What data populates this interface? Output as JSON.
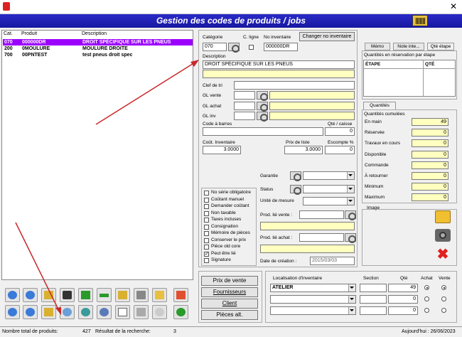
{
  "header": {
    "title": "Gestion des codes de produits / jobs"
  },
  "window": {
    "close": "✕"
  },
  "list": {
    "columns": [
      "Cat.",
      "Produit",
      "Description"
    ],
    "rows": [
      {
        "cat": "070",
        "produit": "000000DR",
        "desc": "DROIT SPÉCIFIQUE SUR LES PNEUS",
        "selected": true
      },
      {
        "cat": "200",
        "produit": "0MOULURE",
        "desc": "MOULURE DROITE",
        "selected": false
      },
      {
        "cat": "700",
        "produit": "00PNTEST",
        "desc": "test pneus droit spec",
        "selected": false
      }
    ]
  },
  "form": {
    "categorie_label": "Catégorie",
    "categorie": "070",
    "cligne_label": "C. ligne",
    "noinv_label": "No inventaire",
    "noinv": "000000DR",
    "change_btn": "Changer no inventaire",
    "description_label": "Description",
    "description": "DROIT SPÉCIFIQUE SUR LES PNEUS",
    "clef_label": "Clef de tri",
    "glvente_label": "GL vente",
    "glachat_label": "GL achat",
    "glinv_label": "GL inv",
    "codebarres_label": "Code à barres",
    "qtecaisse_label": "Qté / caisse",
    "qtecaisse": "0",
    "cout_label": "Coût. Inventaire",
    "cout": "3.0000",
    "prixliste_label": "Prix de liste",
    "prixliste": "3.0000",
    "escompte_label": "Escompte %",
    "escompte": "0",
    "garantie_label": "Garantie",
    "status_label": "Status",
    "unite_label": "Unité de mesure",
    "prodvente_label": "Prod. lié vente :",
    "prodachat_label": "Prod. lié achat :",
    "datecreation_label": "Date de création :",
    "datecreation": "2015/03/03"
  },
  "checks": [
    {
      "label": "No série obligatoire",
      "on": false
    },
    {
      "label": "Coûtant manuel",
      "on": false
    },
    {
      "label": "Demander coûtant",
      "on": false
    },
    {
      "label": "Non taxable",
      "on": false
    },
    {
      "label": "Taxes incluses",
      "on": false
    },
    {
      "label": "Consignation",
      "on": false
    },
    {
      "label": "Mémoire de pièces",
      "on": false
    },
    {
      "label": "Conserver le prix",
      "on": false
    },
    {
      "label": "Pièce old core",
      "on": false
    },
    {
      "label": "Peut être lié",
      "on": true
    },
    {
      "label": "Signature",
      "on": false
    }
  ],
  "right": {
    "tabs": [
      "Mémo",
      "Note inte...",
      "Qté étape"
    ],
    "reserv_title": "Quantités en réservation par étape",
    "reserv_cols": [
      "ÉTAPE",
      "QTÉ"
    ],
    "qtabs": [
      "Quantités"
    ],
    "qcum_title": "Quantités cumulées",
    "quantites": [
      {
        "label": "En main",
        "value": "49"
      },
      {
        "label": "Réservée",
        "value": "0"
      },
      {
        "label": "Travaux en cours",
        "value": "0"
      },
      {
        "label": "Disponible",
        "value": "0"
      },
      {
        "label": "Commande",
        "value": "0"
      },
      {
        "label": "À retourner",
        "value": "0"
      },
      {
        "label": "Minimum",
        "value": "0"
      },
      {
        "label": "Maximum",
        "value": "0"
      }
    ],
    "image_label": "Image"
  },
  "bottom_buttons": [
    "Prix de vente",
    "Fournisseurs",
    "Client",
    "Pièces alt."
  ],
  "locations": {
    "cols": [
      "Localisation d'inventaire",
      "Section",
      "Qté",
      "Achat",
      "Vente"
    ],
    "rows": [
      {
        "loc": "ATELIER",
        "qte": "49",
        "achat": true,
        "vente": true
      },
      {
        "loc": "",
        "qte": "0",
        "achat": false,
        "vente": false
      },
      {
        "loc": "",
        "qte": "0",
        "achat": false,
        "vente": false
      }
    ]
  },
  "status": {
    "total_label": "Nombre total de produits:",
    "total": "427",
    "result_label": "Résultat de la recherche:",
    "result": "3",
    "date": "Aujourd'hui : 26/06/2023"
  }
}
